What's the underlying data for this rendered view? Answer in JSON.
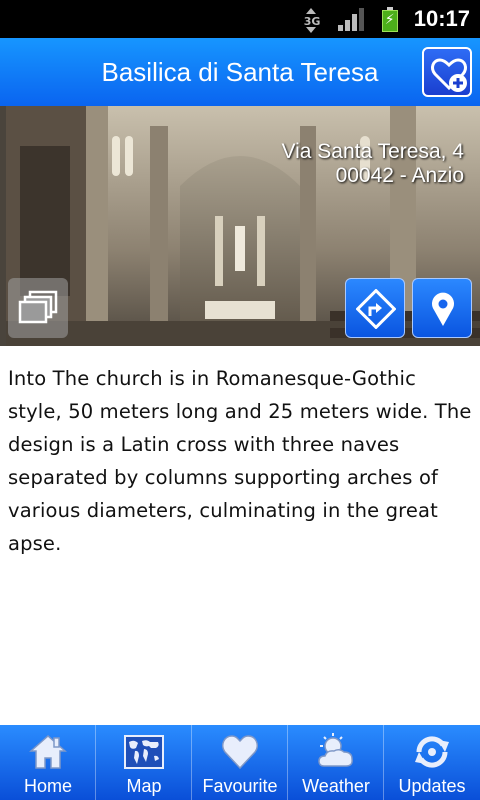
{
  "status_bar": {
    "network_label": "3G",
    "time": "10:17"
  },
  "header": {
    "title": "Basilica di Santa Teresa"
  },
  "hero": {
    "address_line1": "Via Santa Teresa, 4",
    "address_line2": "00042 - Anzio"
  },
  "description": "Into The church is in Romanesque-Gothic style, 50 meters long and 25 meters wide. The design is a Latin cross with three naves separated by columns supporting arches of various diameters, culminating in the great apse.",
  "tabs": [
    {
      "label": "Home",
      "icon": "home-icon"
    },
    {
      "label": "Map",
      "icon": "world-map-icon"
    },
    {
      "label": "Favourite",
      "icon": "heart-icon"
    },
    {
      "label": "Weather",
      "icon": "weather-icon"
    },
    {
      "label": "Updates",
      "icon": "refresh-icon"
    }
  ],
  "colors": {
    "header_blue": "#0a64f0",
    "tab_blue": "#0a4fd8",
    "battery_green": "#4caf1a"
  }
}
